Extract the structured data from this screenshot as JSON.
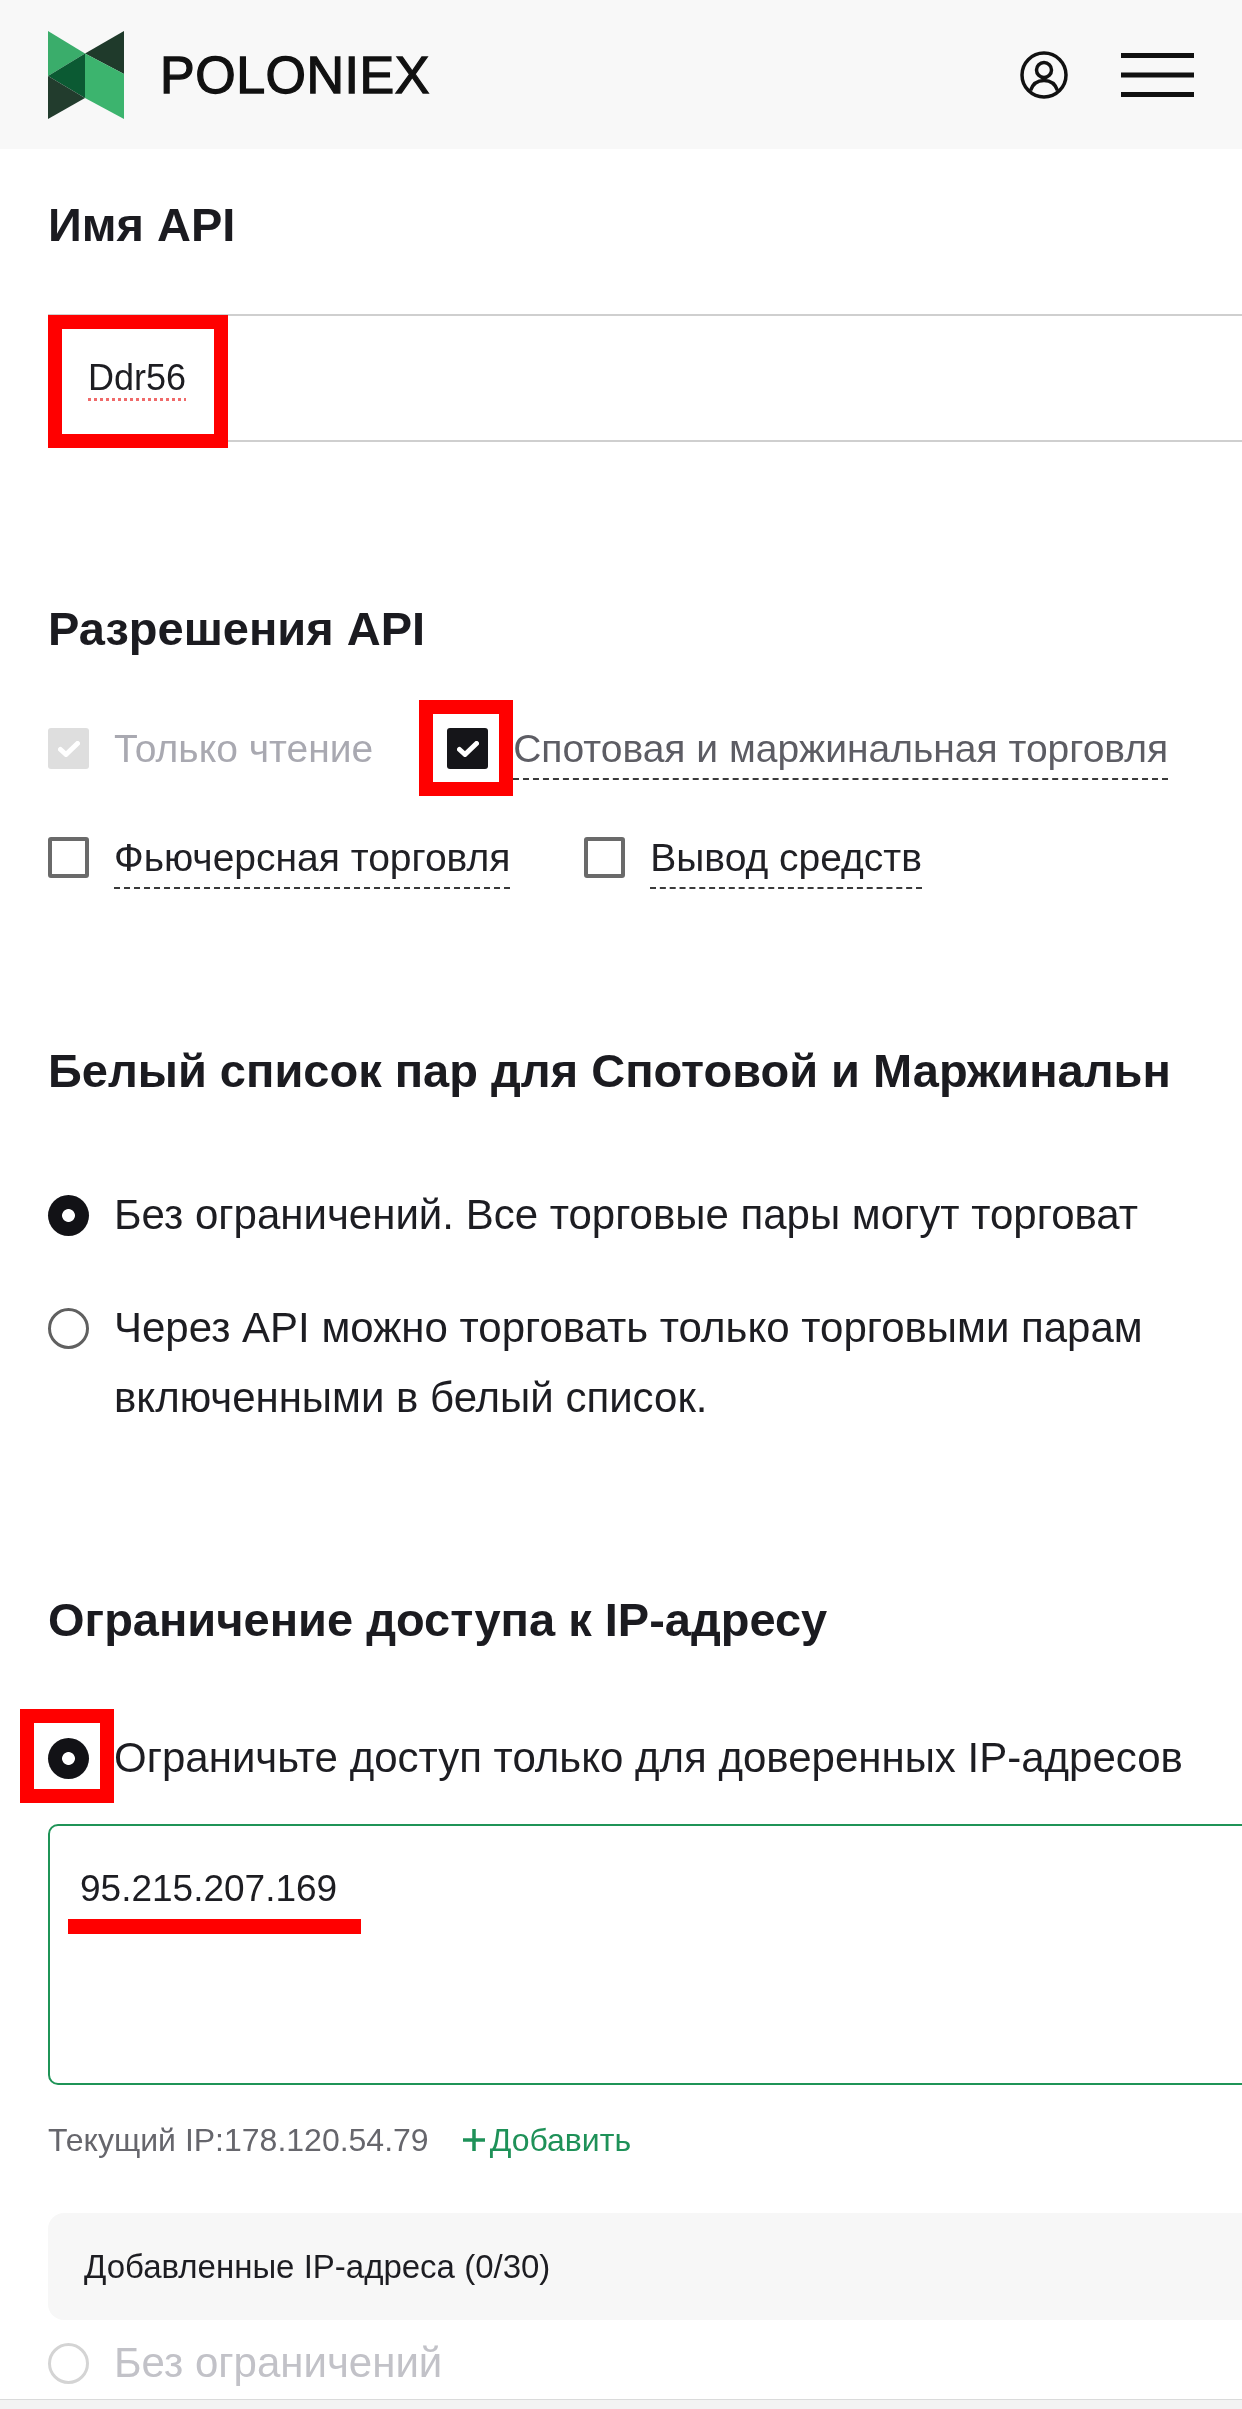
{
  "header": {
    "brand": "POLONIEX"
  },
  "api_name": {
    "title": "Имя API",
    "field": {
      "value": "Ddr56",
      "misspelled": true,
      "annotated": true
    }
  },
  "permissions": {
    "title": "Разрешения API",
    "items": [
      {
        "label": "Только чтение",
        "checked": true,
        "disabled": true,
        "annotated": false
      },
      {
        "label": "Спотовая и маржинальная торговля",
        "checked": true,
        "disabled": false,
        "annotated": true
      },
      {
        "label": "Фьючерсная торговля",
        "checked": false,
        "disabled": false,
        "annotated": false
      },
      {
        "label": "Вывод средств",
        "checked": false,
        "disabled": false,
        "annotated": false
      }
    ]
  },
  "pair_whitelist": {
    "title": "Белый список пар для Спотовой и Маржинальн",
    "options": [
      {
        "label": "Без ограничений. Все торговые пары могут торговат",
        "selected": true
      },
      {
        "label": "Через API можно торговать только торговыми парам\nвключенными в белый список.",
        "selected": false
      }
    ]
  },
  "ip_restriction": {
    "title": "Ограничение доступа к IP-адресу",
    "options": [
      {
        "label": "Ограничьте доступ только для доверенных IP-адресов",
        "selected": true,
        "disabled": false,
        "annotated": true
      },
      {
        "label": "Без ограничений",
        "selected": false,
        "disabled": true,
        "annotated": false
      }
    ],
    "ip_field": {
      "value": "95.215.207.169",
      "annotated": true
    },
    "current_ip": "Текущий IP:178.120.54.79",
    "add_link": {
      "label": "Добавить"
    },
    "added_panel": {
      "label": "Добавленные IP-адреса (0/30)"
    }
  }
}
